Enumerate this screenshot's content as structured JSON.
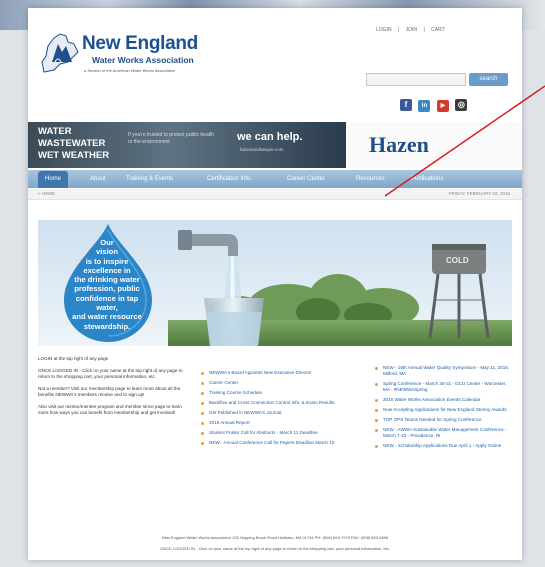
{
  "header": {
    "logo_name": "New England",
    "logo_sub": "Water Works Association",
    "logo_tag": "a Section of the American Water Works Association",
    "top_links": [
      "LOGIN",
      "|",
      "JOIN",
      "|",
      "CART"
    ],
    "search_button": "search"
  },
  "social": [
    {
      "icon": "facebook-icon",
      "glyph": "f",
      "color": "#3b5998"
    },
    {
      "icon": "linkedin-icon",
      "glyph": "in",
      "color": "#3a88c5"
    },
    {
      "icon": "youtube-icon",
      "glyph": "▶",
      "color": "#d23b2f"
    },
    {
      "icon": "instagram-icon",
      "glyph": "◎",
      "color": "#3c3c3c"
    }
  ],
  "banner": {
    "title_1": "WATER",
    "title_2": "WASTEWATER",
    "title_3": "WET WEATHER",
    "small": "If you're trusted to protect public health or the environment",
    "help": "we can help.",
    "url": "hazenandsawyer.com",
    "brand": "Hazen"
  },
  "nav": [
    "Home",
    "About",
    "Training & Events",
    "Certification Info.",
    "Career Center",
    "Resources",
    "Publications"
  ],
  "breadcrumb": "» HOME",
  "date": "FRIDAY, FEBRUARY 19, 2016",
  "hero": {
    "vision_lines": [
      "Our",
      "vision",
      "is to inspire",
      "excellence in",
      "the drinking water",
      "profession, public",
      "confidence in tap water,",
      "and water resource",
      "stewardship."
    ],
    "tower_label": "COLD"
  },
  "left_column": {
    "p1": "LOGIN at the top right of any page",
    "p2": "ONCE LOGGED IN - Click on your name at the top right of any page to return to the shopping cart, your personal information, etc.",
    "p3": "Not a member? Visit our membership page to learn more about all the benefits NEWWA's members receive and to sign up!",
    "p4": "Also visit our mentor/mentee program and member since page to learn more how ways you can benefit from membership and get involved!"
  },
  "mid_list": [
    "NEWWA's Board Appoints New Executive Director",
    "Career Center",
    "Training Course Schedule",
    "Backflow and Cross Connection Control Info. & Exam Results",
    "Get Published in NEWWA's Journal",
    "2015 Annual Report",
    "Student Poster Call for Abstracts - March 11 Deadline",
    "NEW - Annual Conference Call for Papers Deadline March 15"
  ],
  "right_list": [
    "NEW - 18th Annual Water Quality Symposium - May 11, 2016, Milford, MA",
    "Spring Conference - March 30-31 - DCU Center - Worcester, MA - #NEWWASpring",
    "2016 Water Works Association Events Calendar",
    "Now Accepting Applications for New England Stormy Awards",
    "TOP OPS Teams Needed for Spring Conference",
    "NEW - AWWA Sustainable Water Management Conference - March 7-10 - Providence, RI",
    "NEW - Scholarship Applications Due April 1 - Apply Online"
  ],
  "footer": {
    "line1": "New England Water Works Association   125 Hopping Brook Road   Holliston, MA  01746   PH: (508) 893-7979   FAX: (508) 893-9898",
    "line2": "ONCE LOGGED IN - Click on your name at the top right of any page to return to the shopping cart, your personal information, etc."
  },
  "colors": {
    "brand_blue": "#1d4f91",
    "nav_blue": "#7fa6c8",
    "nav_active": "#3f77ad",
    "bullet_orange": "#f09a3e",
    "pointer_red": "#d62020"
  }
}
